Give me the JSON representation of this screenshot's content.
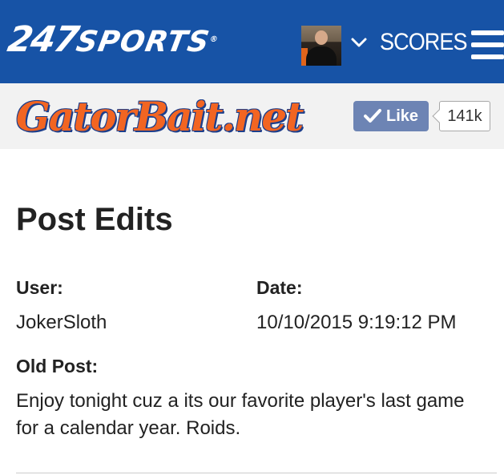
{
  "header": {
    "brand_number": "247",
    "brand_word": "SPORTS",
    "brand_mark": "®",
    "scores_label": "SCORES",
    "avatar_icon": "user-avatar",
    "menu_icon": "hamburger-menu-icon",
    "bg_color": "#1753a6"
  },
  "site": {
    "logo_text": "GatorBait.net",
    "like_label": "Like",
    "like_count": "141k",
    "logo_color": "#f26522",
    "like_color": "#6d84b4"
  },
  "content": {
    "title": "Post Edits",
    "user_label": "User:",
    "user_value": "JokerSloth",
    "date_label": "Date:",
    "date_value": "10/10/2015 9:19:12 PM",
    "old_post_label": "Old Post:",
    "old_post_text": "Enjoy tonight cuz a its our favorite player's last game for a calendar year. Roids."
  }
}
